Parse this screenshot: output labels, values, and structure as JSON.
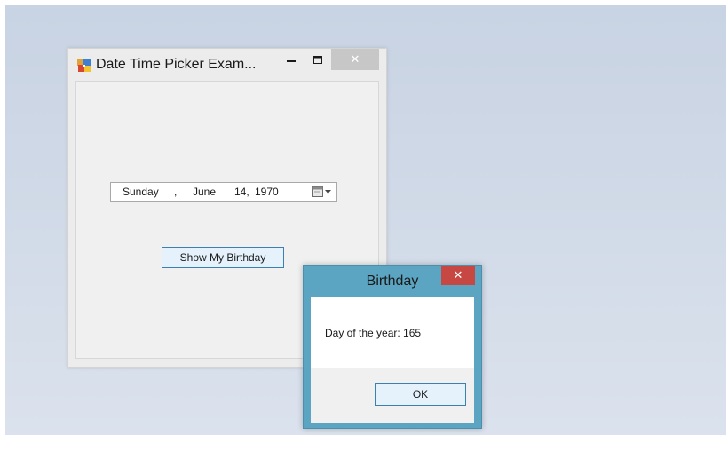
{
  "main_window": {
    "title": "Date Time Picker Exam...",
    "icon": "windows-form-icon",
    "minimize_glyph": "−",
    "maximize_icon": "maximize-icon",
    "close_glyph": "✕",
    "date_picker": {
      "weekday": "Sunday",
      "separator": ",",
      "month": "June",
      "day": "14,",
      "year": "1970",
      "dropdown_icon": "calendar-dropdown-icon"
    },
    "show_button_label": "Show My Birthday"
  },
  "message_box": {
    "title": "Birthday",
    "close_glyph": "✕",
    "message": "Day of the year: 165",
    "ok_label": "OK"
  },
  "colors": {
    "message_box_frame": "#5ba5c2",
    "message_box_close": "#c74743",
    "button_focus_border": "#3c7fb1",
    "button_fill": "#e5f1fb"
  }
}
